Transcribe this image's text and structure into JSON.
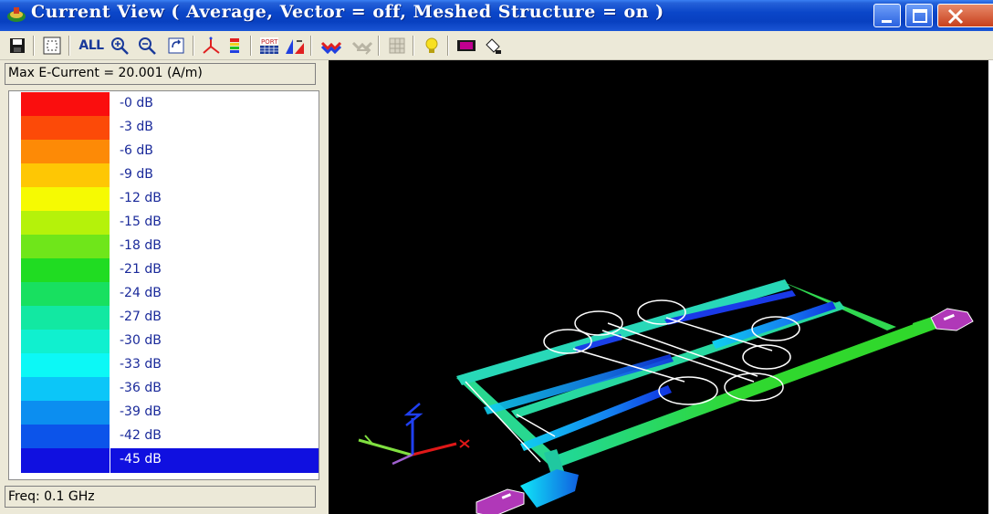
{
  "window": {
    "title": "Current View ( Average, Vector = off, Meshed Structure = on )",
    "controls": [
      "minimize-icon",
      "maximize-icon",
      "close-icon"
    ]
  },
  "toolbar": {
    "all_label": "ALL",
    "tools": [
      "save-icon",
      "fit-view-icon",
      "zoom-all-icon",
      "zoom-in-icon",
      "zoom-out-icon",
      "refresh-view-icon",
      "axis-icon",
      "color-scale-icon",
      "port-icon",
      "mesh-icon",
      "wave-icon",
      "wave-disabled-icon",
      "grid-disabled-icon",
      "lightbulb-icon",
      "color-box-icon",
      "paint-bucket-icon"
    ]
  },
  "panel": {
    "max_current": "Max E-Current = 20.001 (A/m)",
    "freq": "Freq: 0.1 GHz"
  },
  "legend": {
    "items": [
      {
        "label": "-0 dB",
        "color": "#fa0e0e"
      },
      {
        "label": "-3 dB",
        "color": "#fc4a08"
      },
      {
        "label": "-6 dB",
        "color": "#fd8a06"
      },
      {
        "label": "-9 dB",
        "color": "#fec704"
      },
      {
        "label": "-12 dB",
        "color": "#f6fa02"
      },
      {
        "label": "-15 dB",
        "color": "#b5f20a"
      },
      {
        "label": "-18 dB",
        "color": "#6fe61a"
      },
      {
        "label": "-21 dB",
        "color": "#20dc22"
      },
      {
        "label": "-24 dB",
        "color": "#18e060"
      },
      {
        "label": "-27 dB",
        "color": "#12e8a2"
      },
      {
        "label": "-30 dB",
        "color": "#10f0cf"
      },
      {
        "label": "-33 dB",
        "color": "#0cf8f6"
      },
      {
        "label": "-36 dB",
        "color": "#0cc6f8"
      },
      {
        "label": "-39 dB",
        "color": "#0c8ef0"
      },
      {
        "label": "-42 dB",
        "color": "#0c54ea"
      },
      {
        "label": "-45 dB",
        "color": "#1010e0"
      }
    ],
    "selected_index": 15
  },
  "colors": {
    "background": "#000000",
    "trace_green": "#30d82a",
    "port_magenta": "#b038b8",
    "outline_white": "#ffffff"
  }
}
